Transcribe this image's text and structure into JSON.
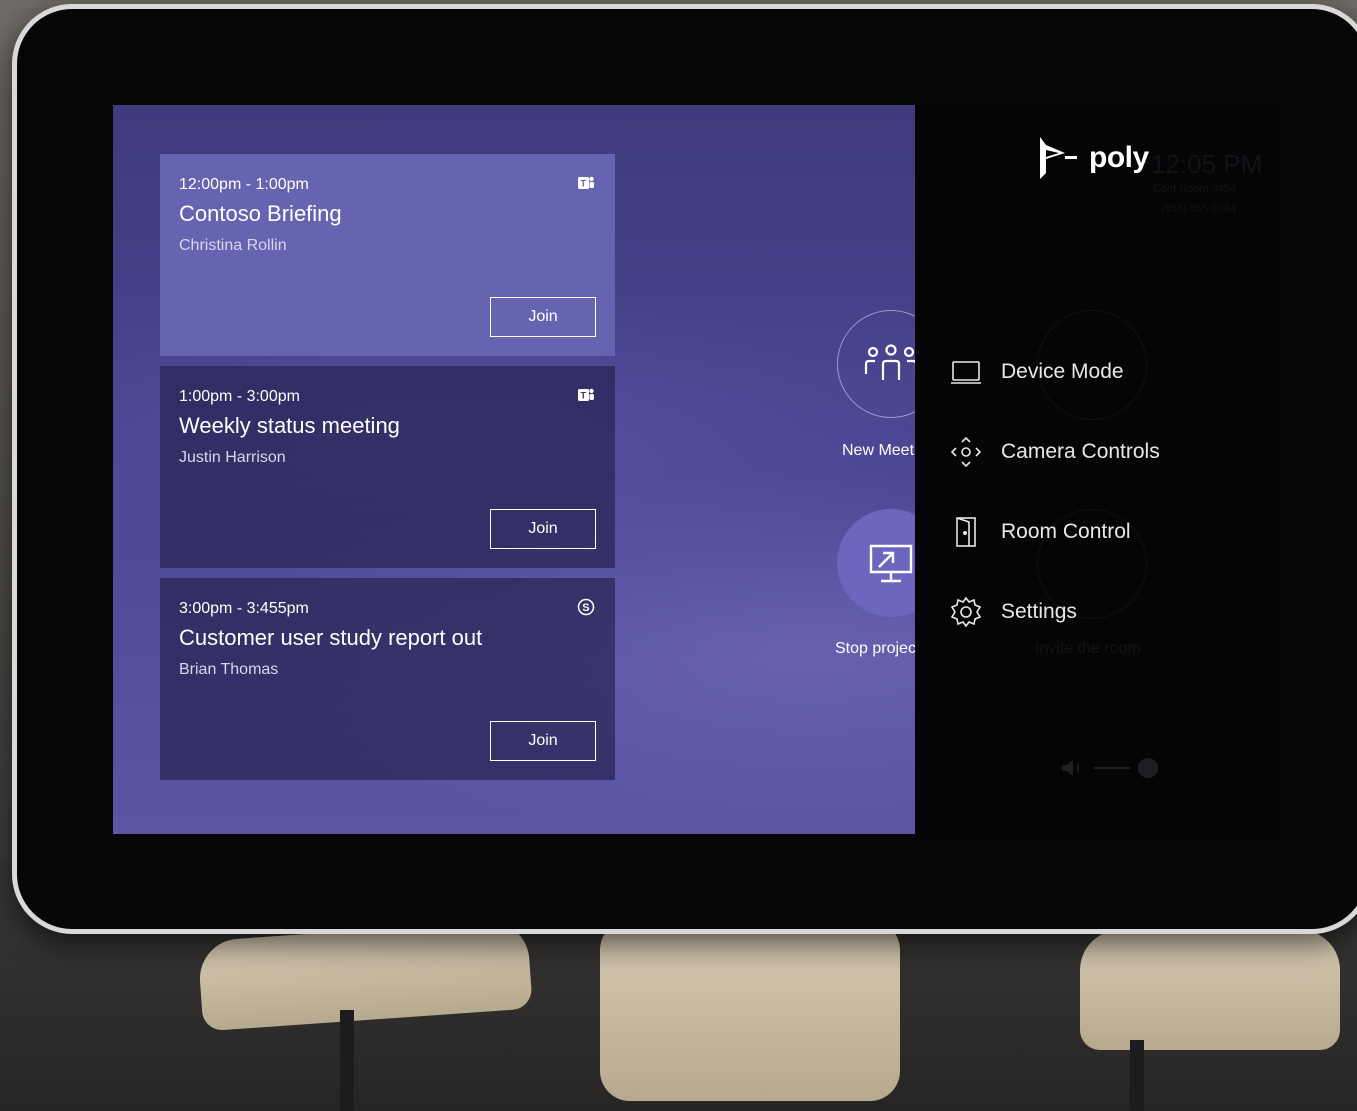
{
  "brand": {
    "logo_text": "poly"
  },
  "meetings": [
    {
      "time": "12:00pm - 1:00pm",
      "title": "Contoso Briefing",
      "host": "Christina Rollin",
      "service_icon": "teams-icon",
      "join_label": "Join",
      "active": true
    },
    {
      "time": "1:00pm - 3:00pm",
      "title": "Weekly status meeting",
      "host": "Justin Harrison",
      "service_icon": "teams-icon",
      "join_label": "Join",
      "active": false
    },
    {
      "time": "3:00pm - 3:455pm",
      "title": "Customer user study report out",
      "host": "Brian Thomas",
      "service_icon": "skype-icon",
      "join_label": "Join",
      "active": false
    }
  ],
  "actions": {
    "new_meeting_label": "New Meeting",
    "stop_projecting_label": "Stop projecting"
  },
  "background_status": {
    "clock": "12:05 PM",
    "room_name": "Conf Room 3454",
    "phone": "(555) 555-9384",
    "invite_label": "Invite the room"
  },
  "menu": {
    "items": [
      {
        "label": "Device Mode",
        "icon": "laptop-icon"
      },
      {
        "label": "Camera Controls",
        "icon": "camera-move-icon"
      },
      {
        "label": "Room Control",
        "icon": "door-icon"
      },
      {
        "label": "Settings",
        "icon": "gear-icon"
      }
    ]
  },
  "colors": {
    "active_card": "#6564b0",
    "menu_background": "#050508",
    "accent": "#6b67bf"
  }
}
